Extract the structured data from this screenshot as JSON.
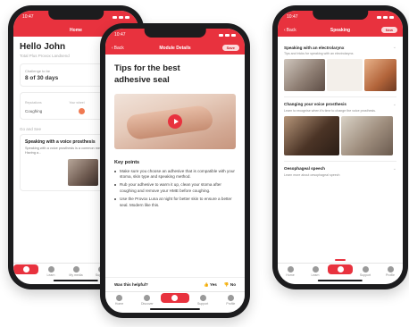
{
  "status": {
    "time": "10:47"
  },
  "left_phone": {
    "appbar_title": "Home",
    "greeting": "Hello John",
    "subtitle": "Total Plus Provox Landsend",
    "progress_card": {
      "label": "Challenge to be",
      "value": "8 of 30 days"
    },
    "mood_card": {
      "label1": "Reputations",
      "label2": "Coughing",
      "col1": "Your wheel",
      "col2": "Your mood"
    },
    "section_label": "Go and See",
    "article": {
      "title": "Speaking with a voice prosthesis",
      "text": "Speaking with a voice prosthesis is a common method used today. Having a..."
    },
    "tabs": [
      "Home",
      "Learn",
      "My media",
      "Support",
      "Profile"
    ]
  },
  "center_phone": {
    "back_label": "Back",
    "appbar_title": "Module Details",
    "pill": "Save",
    "title": "Tips for the best adhesive seal",
    "key_points_label": "Key points",
    "bullets": [
      "Make sure you choose an adhesive that is compatible with your stoma, skin type and speaking method.",
      "Rub your adhesive to warm it up, clean your stoma after coughing and remove your HME before coughing.",
      "Use the Provox Luna at night for better skin to ensure a better seal. Modern like this."
    ],
    "helpful_question": "Was this helpful?",
    "yes": "Yes",
    "no": "No",
    "tabs": [
      "Home",
      "Discover",
      "Centre",
      "Support",
      "Profile"
    ]
  },
  "right_phone": {
    "back_label": "Back",
    "appbar_title": "Speaking",
    "pill": "New",
    "cards": [
      {
        "title": "Speaking with an electrolarynx",
        "text": "Tips and tricks for speaking with an electrolarynx."
      },
      {
        "title": "Changing your voice prosthesis",
        "text": "Learn to recognise when it's time to change the voice prosthesis."
      },
      {
        "title": "Oesophageal speech",
        "text": "Learn more about oesophageal speech"
      }
    ],
    "tabs": [
      "Home",
      "Learn",
      "Centre",
      "Support",
      "Profile"
    ]
  },
  "colors": {
    "brand_red": "#e8323e",
    "mood_orange": "#f07a52",
    "mood_yellow": "#f5c842"
  }
}
